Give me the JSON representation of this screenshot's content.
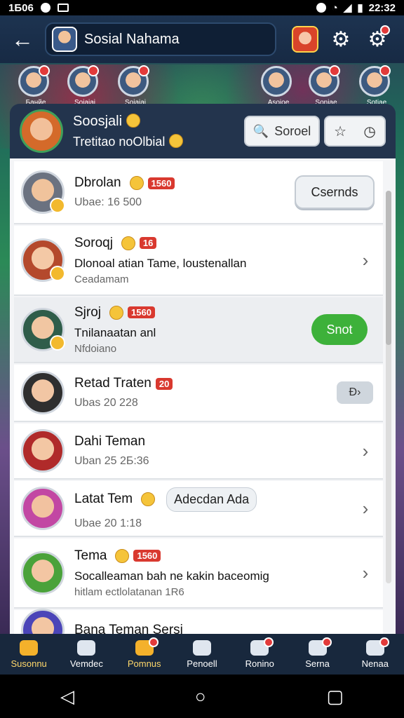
{
  "status": {
    "time_left": "1Б06",
    "time_right": "22:32"
  },
  "header": {
    "title": "Sosial Nahama"
  },
  "friends": [
    {
      "name": "Банйе",
      "notify": true
    },
    {
      "name": "Soiaiai",
      "notify": true
    },
    {
      "name": "Soiaiai",
      "notify": true
    },
    {
      "name": "Asoioe",
      "notify": false
    },
    {
      "name": "Soniae",
      "notify": true
    },
    {
      "name": "Sotiae",
      "notify": true
    }
  ],
  "profile": {
    "name": "Soosjali",
    "subtitle": "Tretitao noOlbial",
    "search_label": "Soroel"
  },
  "list": [
    {
      "title": "Dbrolan",
      "badge": "1560",
      "sub": "Ubae: 16   500",
      "action": "Csernds",
      "action_type": "pill"
    },
    {
      "title": "Soroqj",
      "badge": "16",
      "line2": "Dlonoal atian Tame, loustenallan",
      "line3": "Ceadamam",
      "action_type": "chevron"
    },
    {
      "title": "Sjroj",
      "badge": "1560",
      "line2": "Tnilanaatan anl",
      "line3": "Nfdoiano",
      "action": "Snot",
      "action_type": "green"
    },
    {
      "title": "Retad Traten",
      "badge": "20",
      "sub": "Ubas 20   228",
      "action": "Ɖ",
      "action_type": "small"
    },
    {
      "title": "Dahi Teman",
      "badge": "",
      "sub": "Uban 25   2Б:36",
      "action_type": "chevron"
    },
    {
      "title": "Latat Tem",
      "badge": "",
      "tag": "Adecdan Ada",
      "sub": "Ubae 20   1:18",
      "action_type": "chevron"
    },
    {
      "title": "Tema",
      "badge": "1560",
      "line2": "Socalleaman bah ne kakin baceomig",
      "line3": "hitlam ectlolatanan 1R6",
      "action_type": "chevron"
    },
    {
      "title": "Bana Teman Sersi",
      "badge": "",
      "sub": "",
      "action_type": "none"
    }
  ],
  "bottom_nav": [
    {
      "label": "Susonnu",
      "active": true,
      "notify": false
    },
    {
      "label": "Vemdec",
      "active": false,
      "notify": false
    },
    {
      "label": "Pomnus",
      "active": true,
      "notify": true
    },
    {
      "label": "Penoell",
      "active": false,
      "notify": false
    },
    {
      "label": "Ronino",
      "active": false,
      "notify": true
    },
    {
      "label": "Serna",
      "active": false,
      "notify": true
    },
    {
      "label": "Nenaa",
      "active": false,
      "notify": true
    }
  ]
}
